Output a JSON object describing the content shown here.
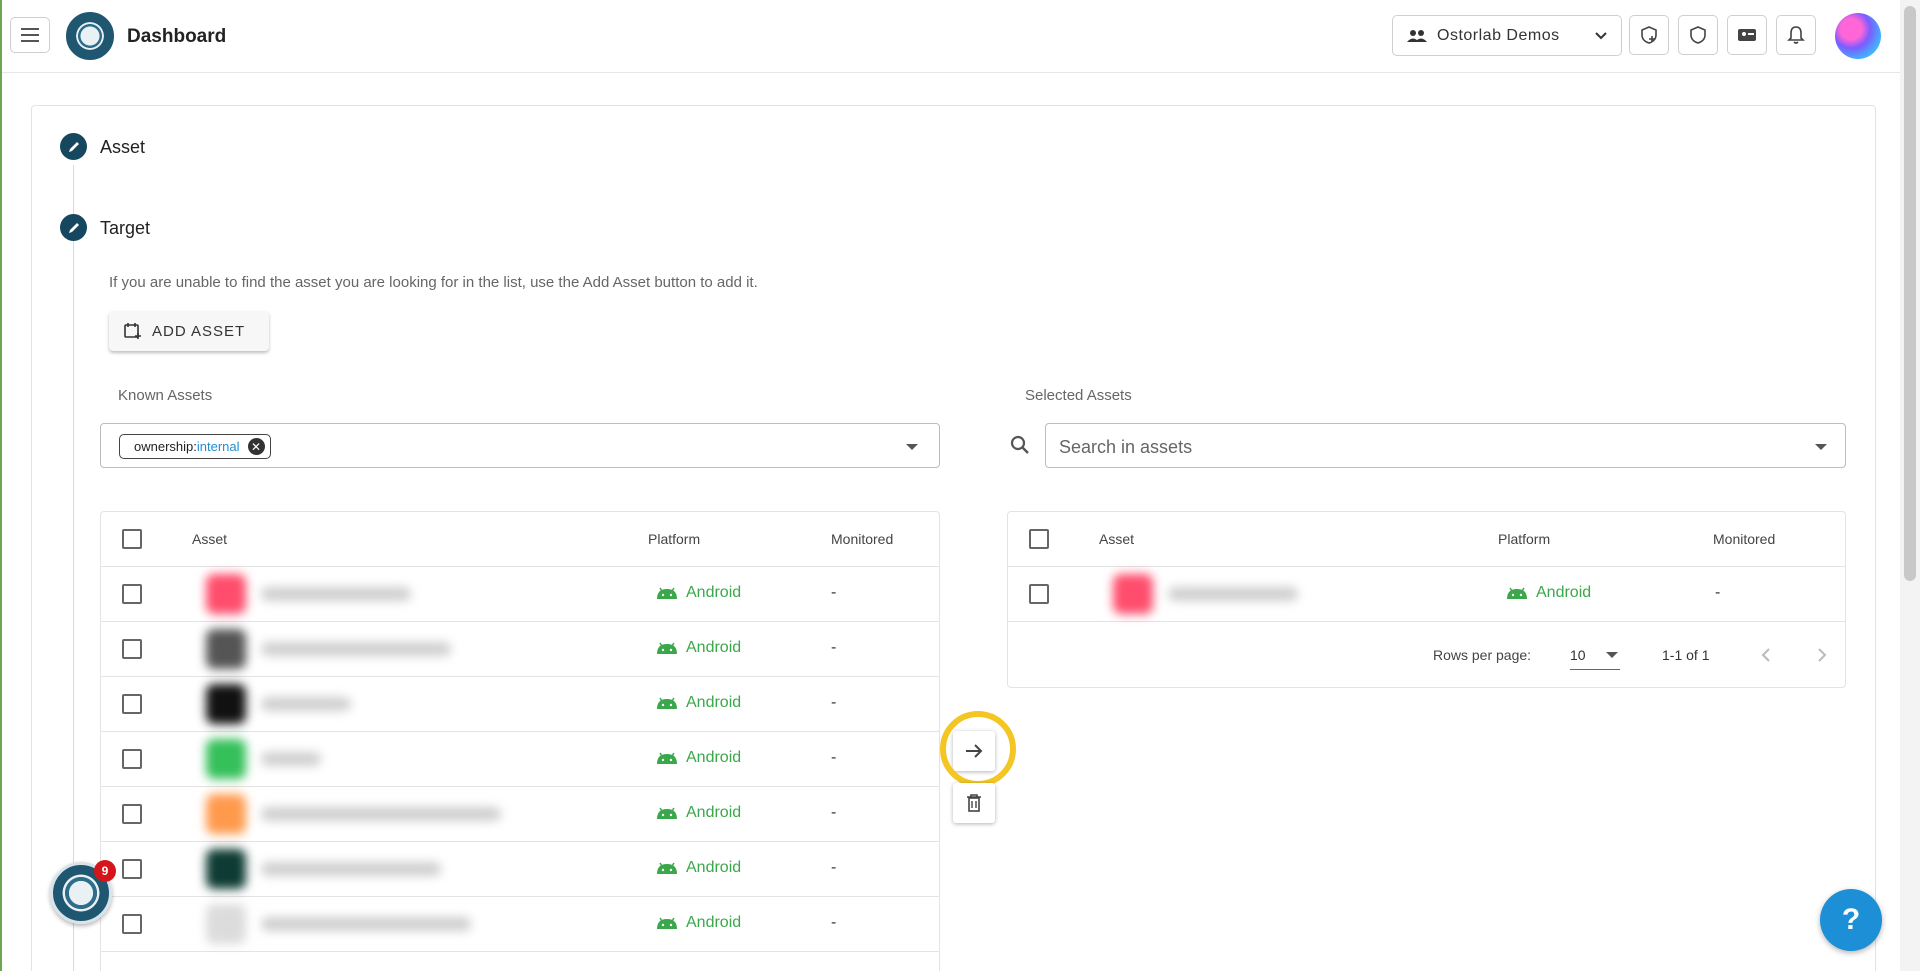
{
  "header": {
    "title": "Dashboard",
    "organization": "Ostorlab Demos",
    "icons": [
      "menu-icon",
      "add-scan-icon",
      "shield-icon",
      "ticket-icon",
      "bell-icon"
    ]
  },
  "steps": [
    {
      "label": "Asset"
    },
    {
      "label": "Target"
    }
  ],
  "target": {
    "info": "If you are unable to find the asset you are looking for in the list, use the Add Asset button to add it.",
    "add_asset_label": "ADD ASSET"
  },
  "known_assets": {
    "label": "Known Assets",
    "filter_chip": {
      "key": "ownership:",
      "value": "internal"
    },
    "columns": [
      "Asset",
      "Platform",
      "Monitored"
    ],
    "rows": [
      {
        "platform": "Android",
        "monitored": "-",
        "color": "#ff4d6d"
      },
      {
        "platform": "Android",
        "monitored": "-",
        "color": "#555555"
      },
      {
        "platform": "Android",
        "monitored": "-",
        "color": "#111111"
      },
      {
        "platform": "Android",
        "monitored": "-",
        "color": "#35c05a"
      },
      {
        "platform": "Android",
        "monitored": "-",
        "color": "#ff9a4d"
      },
      {
        "platform": "Android",
        "monitored": "-",
        "color": "#0e3b33"
      },
      {
        "platform": "Android",
        "monitored": "-",
        "color": "#dcdcdc"
      }
    ]
  },
  "selected_assets": {
    "label": "Selected Assets",
    "search_placeholder": "Search in assets",
    "columns": [
      "Asset",
      "Platform",
      "Monitored"
    ],
    "rows": [
      {
        "platform": "Android",
        "monitored": "-",
        "color": "#ff4d6d"
      }
    ],
    "pagination": {
      "rows_per_page_label": "Rows per page:",
      "rows_per_page": "10",
      "range": "1-1 of 1"
    }
  },
  "chat_badge": "9",
  "help_label": "?",
  "colors": {
    "primary": "#15475e",
    "android": "#3aa84a",
    "highlight": "#f3c623",
    "help": "#1c8fd6"
  }
}
